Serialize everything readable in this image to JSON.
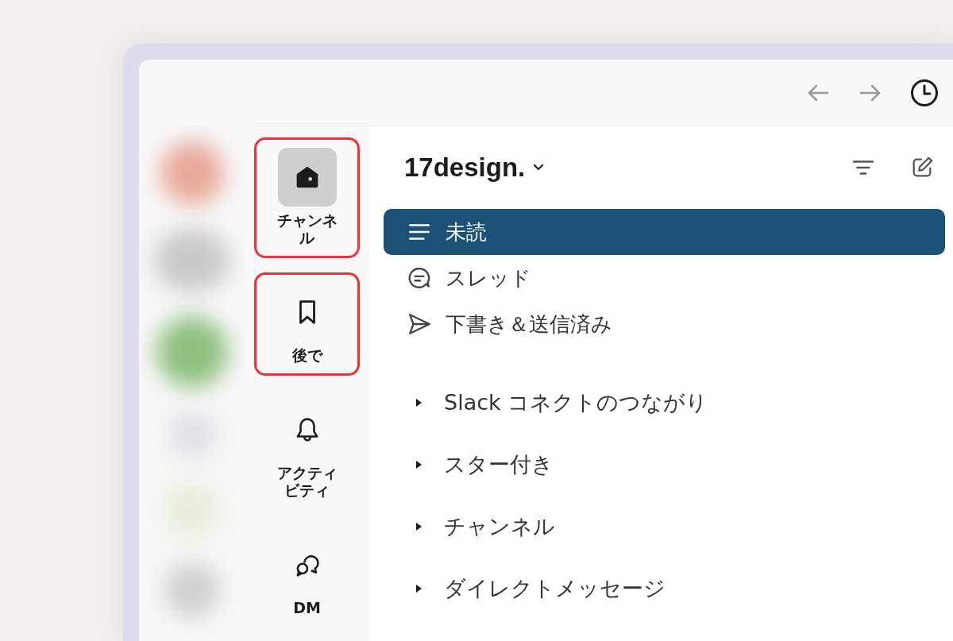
{
  "rail_items": [
    {
      "label": "チャンネル",
      "kind": "home",
      "selected": true,
      "highlighted": true
    },
    {
      "label": "後で",
      "kind": "bookmark",
      "selected": false,
      "highlighted": true
    },
    {
      "label": "アクティビティ",
      "kind": "bell",
      "selected": false,
      "highlighted": false
    },
    {
      "label": "DM",
      "kind": "chat",
      "selected": false,
      "highlighted": false
    }
  ],
  "workspace": {
    "name": "17design."
  },
  "views": [
    {
      "label": "未読",
      "kind": "unread",
      "selected": true
    },
    {
      "label": "スレッド",
      "kind": "threads",
      "selected": false
    },
    {
      "label": "下書き＆送信済み",
      "kind": "drafts",
      "selected": false
    }
  ],
  "sections": [
    {
      "label": "Slack コネクトのつながり",
      "expanded": false
    },
    {
      "label": "スター付き",
      "expanded": false
    },
    {
      "label": "チャンネル",
      "expanded": false
    },
    {
      "label": "ダイレクトメッセージ",
      "expanded": false
    }
  ]
}
